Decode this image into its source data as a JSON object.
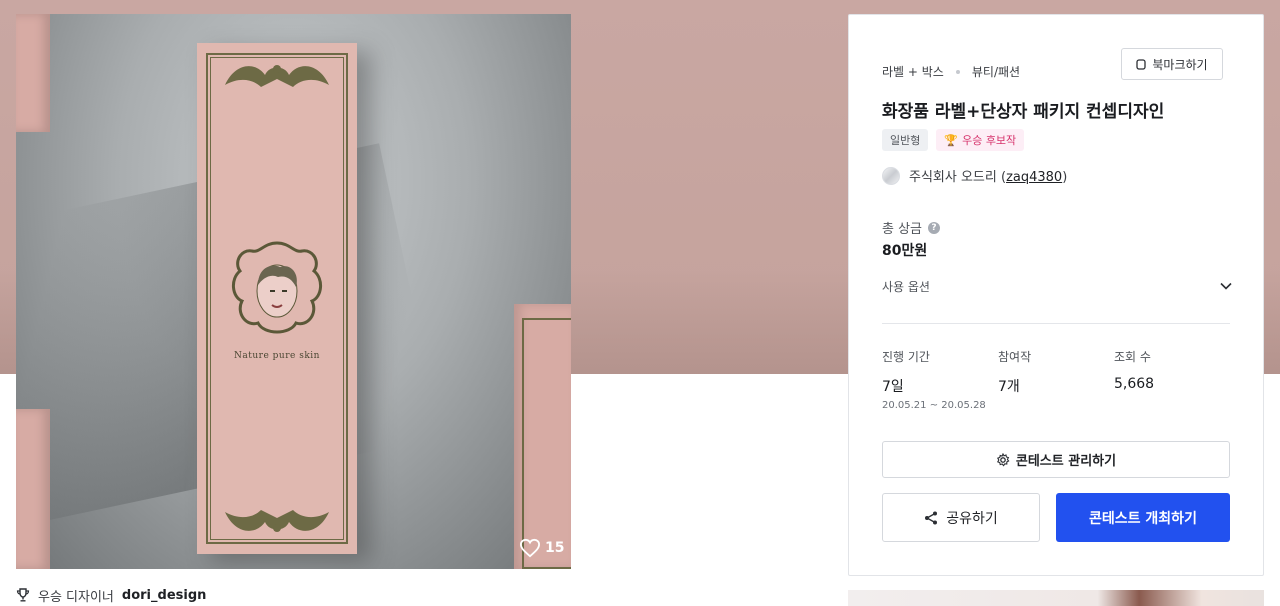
{
  "gallery": {
    "likes": "15",
    "box_brand_text": "Nature pure skin",
    "winner_label": "우승 디자이너",
    "winner_name": "dori_design"
  },
  "contest": {
    "category_main": "라벨 + 박스",
    "category_sub": "뷰티/패션",
    "bookmark_label": "북마크하기",
    "title": "화장품 라벨+단상자 패키지 컨셉디자인",
    "badge_type": "일반형",
    "badge_award": "우승 후보작",
    "host_name": "주식회사 오드리 (",
    "host_id": "zaq4380",
    "host_close": ")",
    "prize_label": "총 상금",
    "prize_help": "?",
    "prize_value": "80만원",
    "options_label": "사용 옵션",
    "stats": [
      {
        "label": "진행 기간",
        "value": "7일",
        "sub": "20.05.21  ~  20.05.28"
      },
      {
        "label": "참여작",
        "value": "7개",
        "sub": ""
      },
      {
        "label": "조회 수",
        "value": "5,668",
        "sub": ""
      }
    ],
    "manage_label": "콘테스트 관리하기",
    "share_label": "공유하기",
    "host_label": "콘테스트 개최하기"
  },
  "colors": {
    "primary": "#2251ef",
    "hero_bg": "#c9a7a2",
    "award_text": "#d6336c",
    "award_bg": "#fdeef6"
  },
  "icons": [
    "bookmark-icon",
    "trophy-icon",
    "heart-icon",
    "gear-icon",
    "share-icon",
    "chevron-down-icon",
    "help-icon"
  ]
}
